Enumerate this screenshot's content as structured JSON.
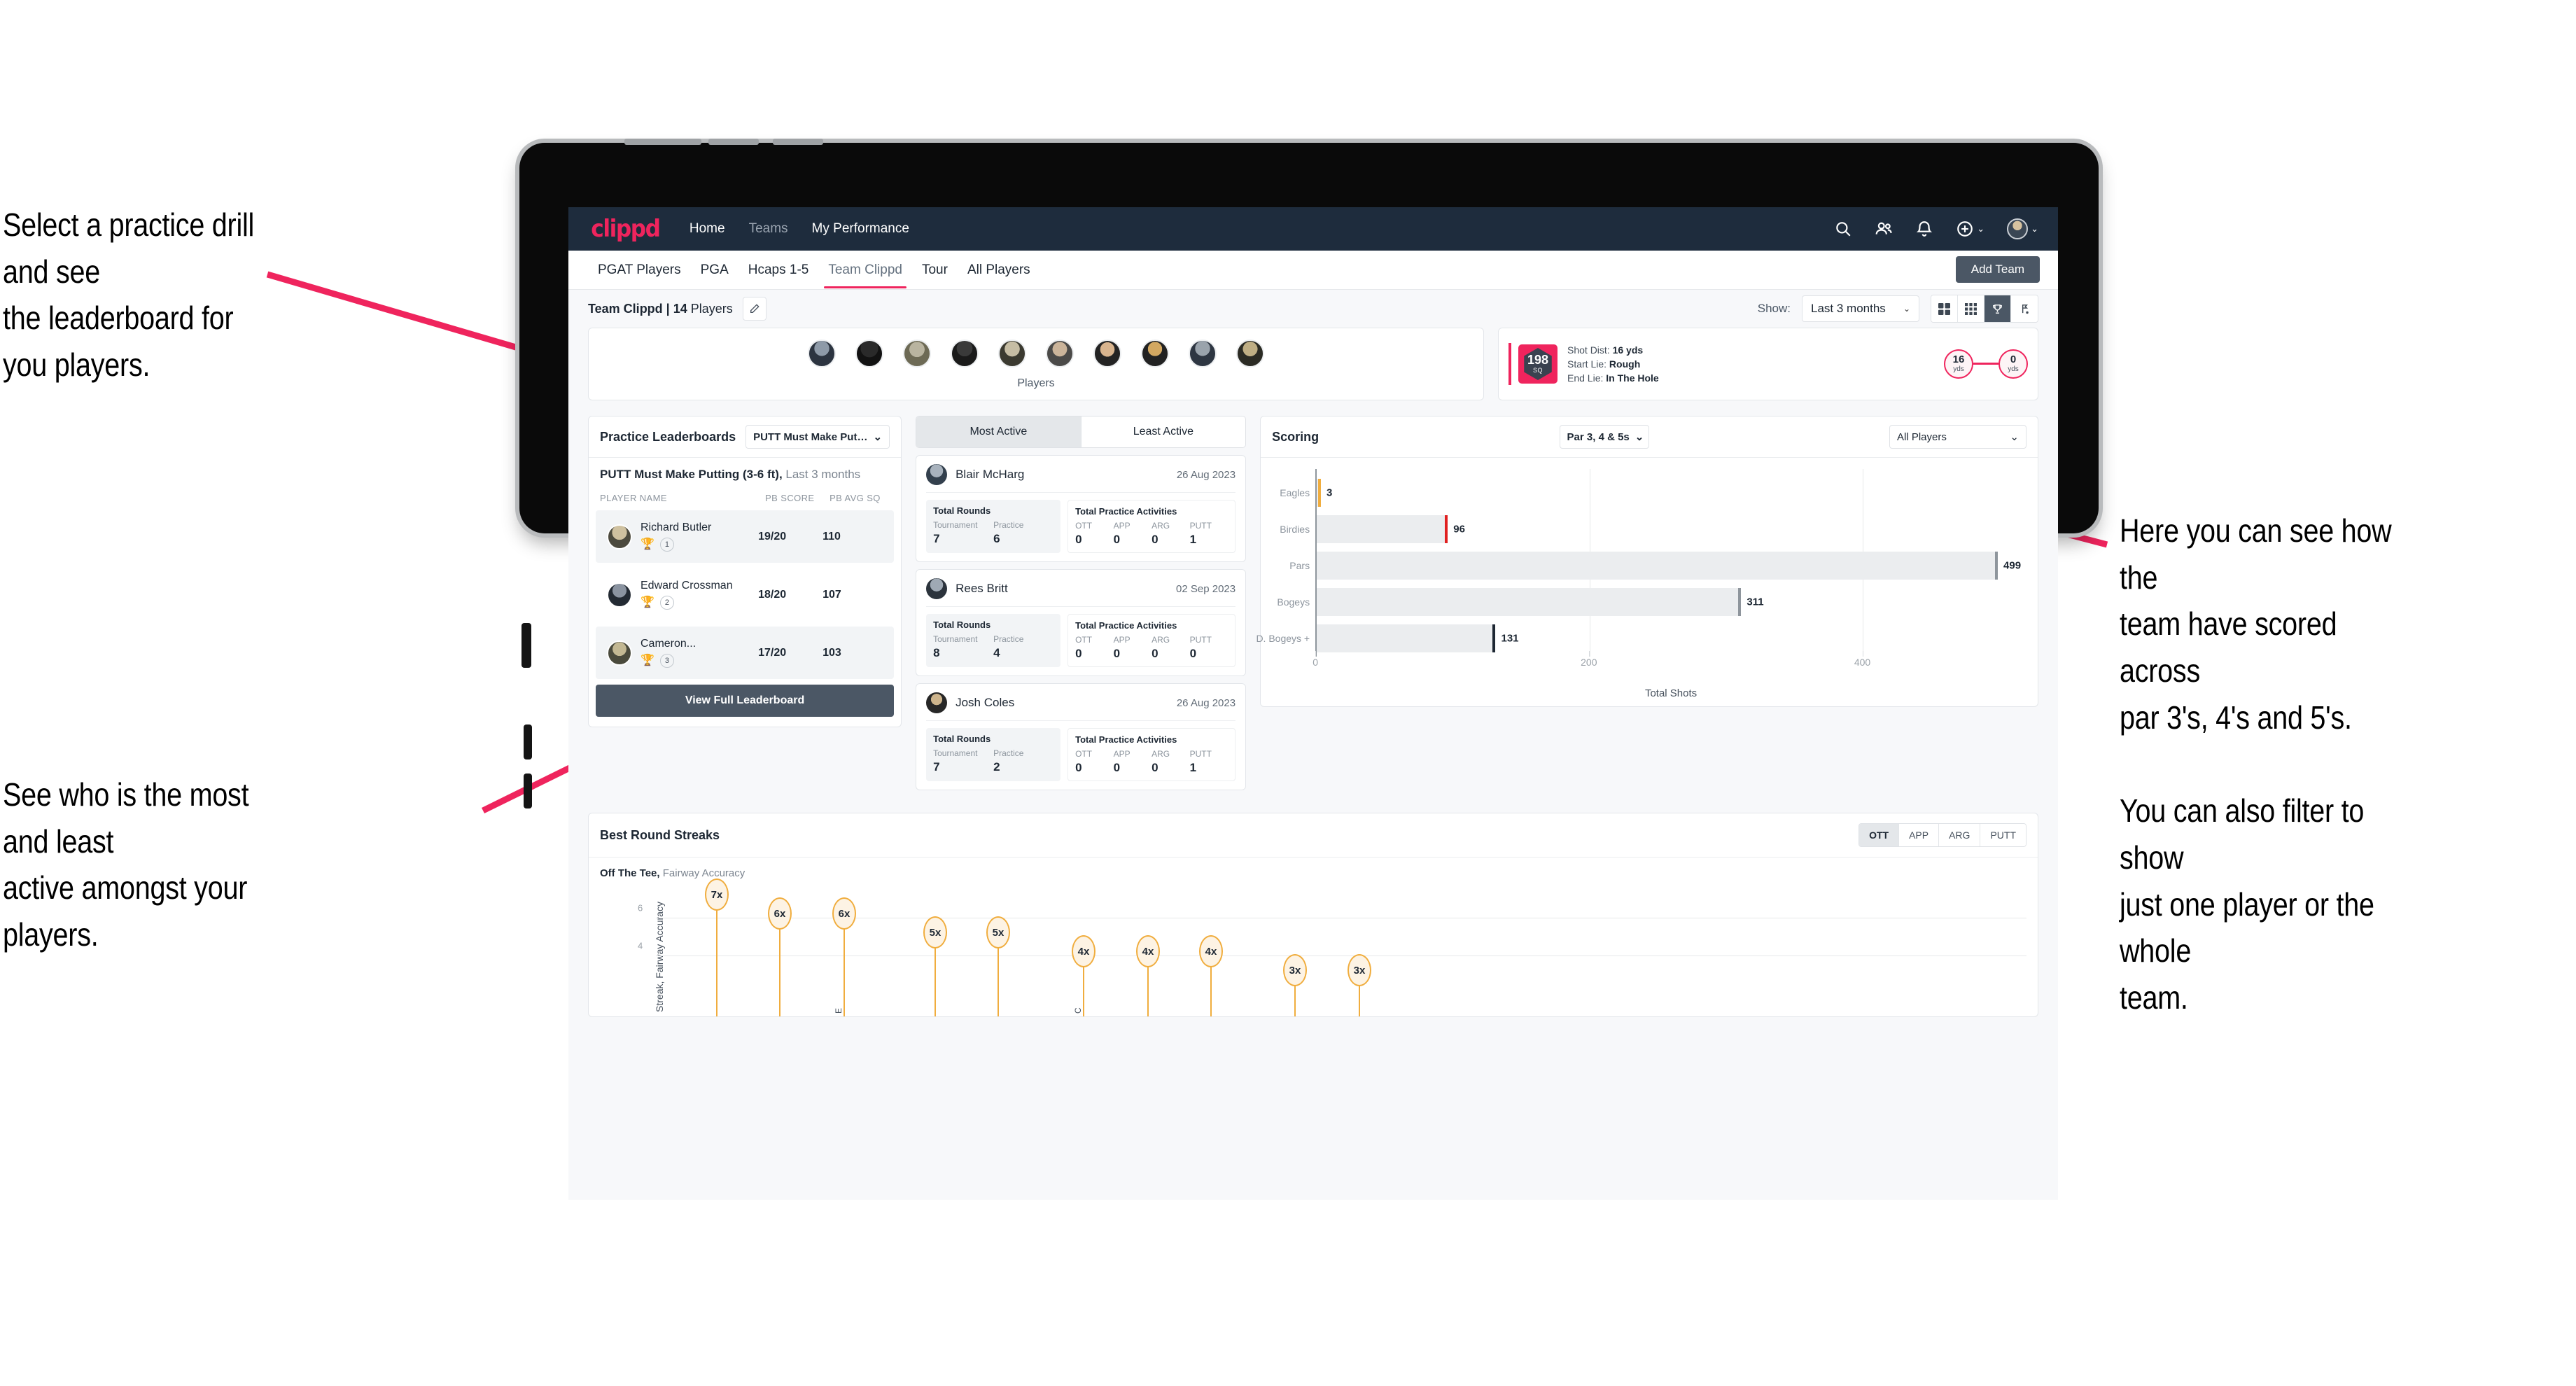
{
  "annotations": {
    "top_left": "Select a practice drill and see\nthe leaderboard for you players.",
    "bottom_left": "See who is the most and least\nactive amongst your players.",
    "right": "Here you can see how the\nteam have scored across\npar 3's, 4's and 5's.\n\nYou can also filter to show\njust one player or the whole\nteam.",
    "arrow_color": "#ef245d"
  },
  "navbar": {
    "brand": "clippd",
    "links": [
      {
        "label": "Home",
        "dim": false
      },
      {
        "label": "Teams",
        "dim": true
      },
      {
        "label": "My Performance",
        "dim": false
      }
    ],
    "icons": [
      "search-icon",
      "people-icon",
      "bell-icon",
      "plus-circle-icon"
    ],
    "caret": "⌄"
  },
  "tabs": {
    "items": [
      {
        "label": "PGAT Players",
        "active": false
      },
      {
        "label": "PGA",
        "active": false
      },
      {
        "label": "Hcaps 1-5",
        "active": false
      },
      {
        "label": "Team Clippd",
        "active": true
      },
      {
        "label": "Tour",
        "active": false
      },
      {
        "label": "All Players",
        "active": false
      }
    ],
    "add_team": "Add Team"
  },
  "toolbar": {
    "team_name": "Team Clippd | 14",
    "team_suffix": " Players",
    "show_label": "Show:",
    "period": "Last 3 months",
    "view_icons": [
      "grid-large-icon",
      "grid-small-icon",
      "trophy-icon",
      "flag-icon"
    ],
    "active_view": 2
  },
  "players_strip": {
    "caption": "Players",
    "count": 10
  },
  "shot_card": {
    "sq_value": "198",
    "sq_label": "SQ",
    "lines": [
      {
        "k": "Shot Dist: ",
        "v": "16 yds"
      },
      {
        "k": "Start Lie: ",
        "v": "Rough"
      },
      {
        "k": "End Lie: ",
        "v": "In The Hole"
      }
    ],
    "start_dist": "16",
    "start_unit": "yds",
    "end_dist": "0",
    "end_unit": "yds"
  },
  "leaderboard": {
    "title": "Practice Leaderboards",
    "drill_select": "PUTT Must Make Putting ...",
    "drill_title": "PUTT Must Make Putting (3-6 ft),",
    "drill_period": " Last 3 months",
    "columns": [
      "PLAYER NAME",
      "PB SCORE",
      "PB AVG SQ"
    ],
    "rows": [
      {
        "name": "Richard Butler",
        "rank": "1",
        "trophy": "gold",
        "score": "19/20",
        "sq": "110"
      },
      {
        "name": "Edward Crossman",
        "rank": "2",
        "trophy": "silver",
        "score": "18/20",
        "sq": "107"
      },
      {
        "name": "Cameron...",
        "rank": "3",
        "trophy": "bronze",
        "score": "17/20",
        "sq": "103"
      }
    ],
    "view_full": "View Full Leaderboard"
  },
  "activity": {
    "tabs": [
      {
        "label": "Most Active",
        "active": true
      },
      {
        "label": "Least Active",
        "active": false
      }
    ],
    "cards": [
      {
        "name": "Blair McHarg",
        "date": "26 Aug 2023",
        "rounds_title": "Total Rounds",
        "rounds": [
          {
            "k": "Tournament",
            "v": "7"
          },
          {
            "k": "Practice",
            "v": "6"
          }
        ],
        "practice_title": "Total Practice Activities",
        "practice": [
          {
            "k": "OTT",
            "v": "0"
          },
          {
            "k": "APP",
            "v": "0"
          },
          {
            "k": "ARG",
            "v": "0"
          },
          {
            "k": "PUTT",
            "v": "1"
          }
        ]
      },
      {
        "name": "Rees Britt",
        "date": "02 Sep 2023",
        "rounds_title": "Total Rounds",
        "rounds": [
          {
            "k": "Tournament",
            "v": "8"
          },
          {
            "k": "Practice",
            "v": "4"
          }
        ],
        "practice_title": "Total Practice Activities",
        "practice": [
          {
            "k": "OTT",
            "v": "0"
          },
          {
            "k": "APP",
            "v": "0"
          },
          {
            "k": "ARG",
            "v": "0"
          },
          {
            "k": "PUTT",
            "v": "0"
          }
        ]
      },
      {
        "name": "Josh Coles",
        "date": "26 Aug 2023",
        "rounds_title": "Total Rounds",
        "rounds": [
          {
            "k": "Tournament",
            "v": "7"
          },
          {
            "k": "Practice",
            "v": "2"
          }
        ],
        "practice_title": "Total Practice Activities",
        "practice": [
          {
            "k": "OTT",
            "v": "0"
          },
          {
            "k": "APP",
            "v": "0"
          },
          {
            "k": "ARG",
            "v": "0"
          },
          {
            "k": "PUTT",
            "v": "1"
          }
        ]
      }
    ]
  },
  "scoring": {
    "title": "Scoring",
    "par_filter": "Par 3, 4 & 5s",
    "player_filter": "All Players"
  },
  "streaks": {
    "title": "Best Round Streaks",
    "segments": [
      {
        "label": "OTT",
        "active": true
      },
      {
        "label": "APP",
        "active": false
      },
      {
        "label": "ARG",
        "active": false
      },
      {
        "label": "PUTT",
        "active": false
      }
    ],
    "sub_bold": "Off The Tee,",
    "sub_rest": " Fairway Accuracy"
  },
  "chart_data": [
    {
      "type": "bar",
      "orientation": "horizontal",
      "title": "Scoring",
      "categories": [
        "Eagles",
        "Birdies",
        "Pars",
        "Bogeys",
        "D. Bogeys +"
      ],
      "values": [
        3,
        96,
        499,
        311,
        131
      ],
      "cap_colors": [
        "#f0ad3e",
        "#e02020",
        "#8e959c",
        "#8e959c",
        "#1d2733"
      ],
      "xlabel": "Total Shots",
      "ylabel": "",
      "xlim": [
        0,
        520
      ],
      "xticks": [
        0,
        200,
        400
      ],
      "grid": true,
      "bar_color": "#ebedef"
    },
    {
      "type": "line",
      "subtype": "lollipop",
      "title": "Best Round Streaks",
      "series_name": "Off The Tee, Fairway Accuracy",
      "ylabel": "Streak, Fairway Accuracy",
      "values": [
        7,
        6,
        6,
        5,
        5,
        4,
        4,
        4,
        3,
        3
      ],
      "labels": [
        "7x",
        "6x",
        "6x",
        "5x",
        "5x",
        "4x",
        "4x",
        "4x",
        "3x",
        "3x"
      ],
      "yticks": [
        4,
        6
      ],
      "ylim": [
        0,
        8
      ],
      "grid": true,
      "marker_color": "#f0ad3e",
      "marker_fill": "#fdf3e4"
    }
  ]
}
